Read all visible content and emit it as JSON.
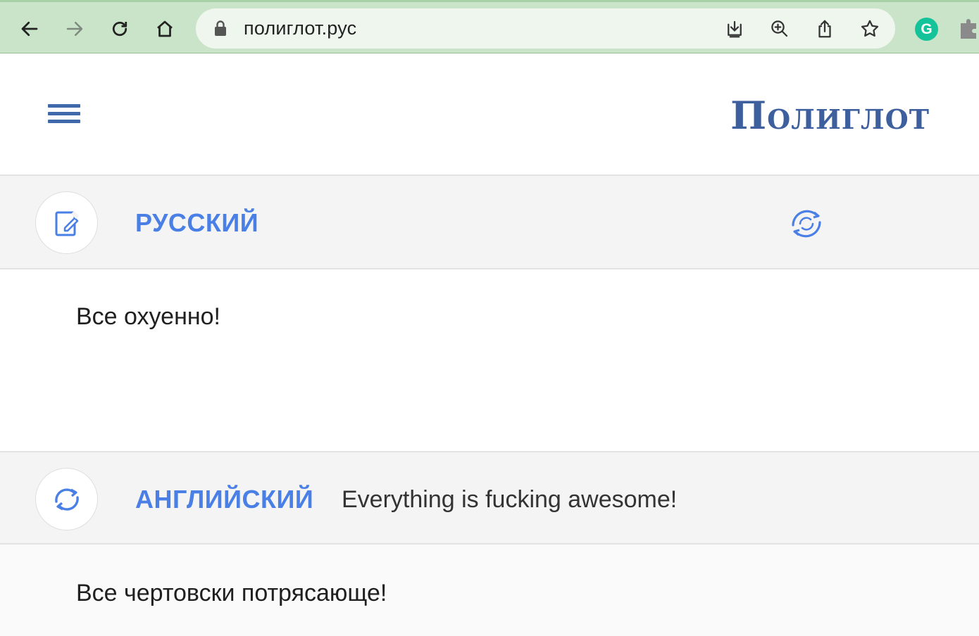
{
  "browser": {
    "url": "полиглот.рус",
    "extension_label": "G"
  },
  "site": {
    "logo": "Полиглот"
  },
  "source": {
    "language": "РУССКИЙ",
    "text": "Все охуенно!"
  },
  "target": {
    "language": "АНГЛИЙСКИЙ",
    "translation": "Everything is fucking awesome!",
    "back_translation": "Все чертовски потрясающе!"
  },
  "colors": {
    "accent": "#4a7fe6",
    "logo": "#3d5f9d",
    "toolbar": "#c9e4c8"
  }
}
